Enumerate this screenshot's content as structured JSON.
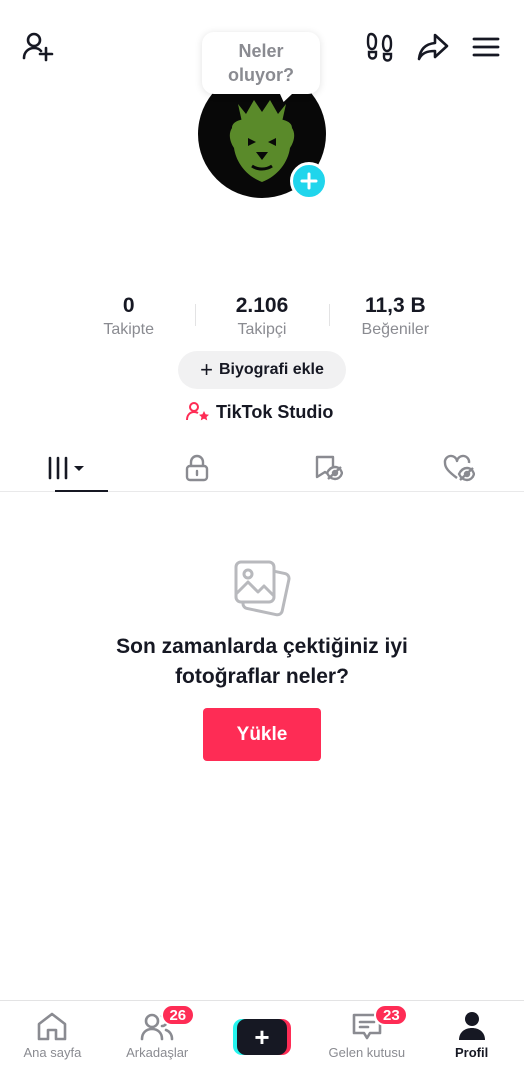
{
  "header": {
    "icons": [
      "add-friend-icon",
      "footprints-icon",
      "share-icon",
      "menu-icon"
    ]
  },
  "bubble": {
    "text": "Neler\noluyor?"
  },
  "stats": [
    {
      "value": "0",
      "label": "Takipte"
    },
    {
      "value": "2.106",
      "label": "Takipçi"
    },
    {
      "value": "11,3 B",
      "label": "Beğeniler"
    }
  ],
  "bio_button": {
    "icon": "+",
    "label": "Biyografi ekle"
  },
  "studio": {
    "label": "TikTok Studio"
  },
  "tabs": {
    "items": [
      "videos-grid-icon",
      "private-lock-icon",
      "saved-icon",
      "liked-icon"
    ],
    "active_index": 0
  },
  "empty_state": {
    "text": "Son zamanlarda çektiğiniz iyi\nfotoğraflar neler?",
    "button": "Yükle"
  },
  "bottom_nav": {
    "home": "Ana sayfa",
    "friends": "Arkadaşlar",
    "friends_badge": "26",
    "create": "+",
    "inbox": "Gelen kutusu",
    "inbox_badge": "23",
    "profile": "Profil"
  },
  "colors": {
    "accent": "#fe2c55",
    "cyan": "#25f4ee",
    "text": "#161823",
    "muted": "#8a8b91",
    "avatar_plus": "#20d5ec",
    "lion_green": "#5a8a2a"
  }
}
